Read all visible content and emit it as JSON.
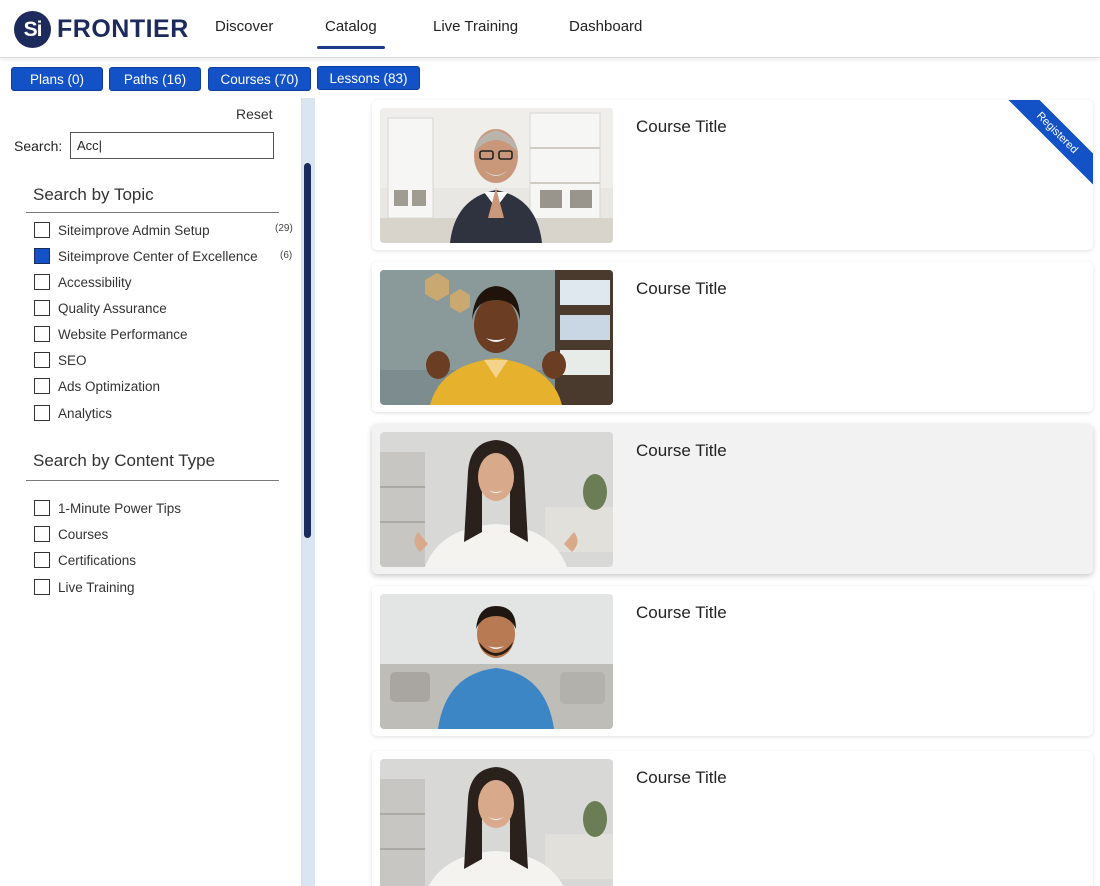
{
  "brand": {
    "logo_mark": "Si",
    "name": "FRONTIER",
    "color": "#1d2a5c"
  },
  "nav": {
    "items": [
      {
        "label": "Discover"
      },
      {
        "label": "Catalog",
        "active": true
      },
      {
        "label": "Live Training"
      },
      {
        "label": "Dashboard"
      }
    ]
  },
  "tabs": [
    {
      "label": "Plans (0)"
    },
    {
      "label": "Paths (16)"
    },
    {
      "label": "Courses (70)"
    },
    {
      "label": "Lessons (83)"
    }
  ],
  "sidebar": {
    "reset_label": "Reset",
    "search_label": "Search:",
    "search_value": "Acc|",
    "topic_section": {
      "title": "Search by Topic",
      "items": [
        {
          "label": "Siteimprove Admin Setup",
          "count": "(29)",
          "checked": false
        },
        {
          "label": "Siteimprove Center of Excellence",
          "count": "(6)",
          "checked": true
        },
        {
          "label": "Accessibility",
          "checked": false
        },
        {
          "label": "Quality Assurance",
          "checked": false
        },
        {
          "label": "Website Performance",
          "checked": false
        },
        {
          "label": "SEO",
          "checked": false
        },
        {
          "label": "Ads Optimization",
          "checked": false
        },
        {
          "label": "Analytics",
          "checked": false
        }
      ]
    },
    "content_section": {
      "title": "Search by Content Type",
      "items": [
        {
          "label": "1-Minute Power Tips",
          "checked": false
        },
        {
          "label": "Courses",
          "checked": false
        },
        {
          "label": "Certifications",
          "checked": false
        },
        {
          "label": "Live Training",
          "checked": false
        }
      ]
    }
  },
  "courses": [
    {
      "title": "Course Title",
      "badge": "Registered"
    },
    {
      "title": "Course Title"
    },
    {
      "title": "Course Title"
    },
    {
      "title": "Course Title"
    },
    {
      "title": "Course Title"
    }
  ],
  "colors": {
    "accent": "#1351c7",
    "brand": "#1d2a5c"
  }
}
